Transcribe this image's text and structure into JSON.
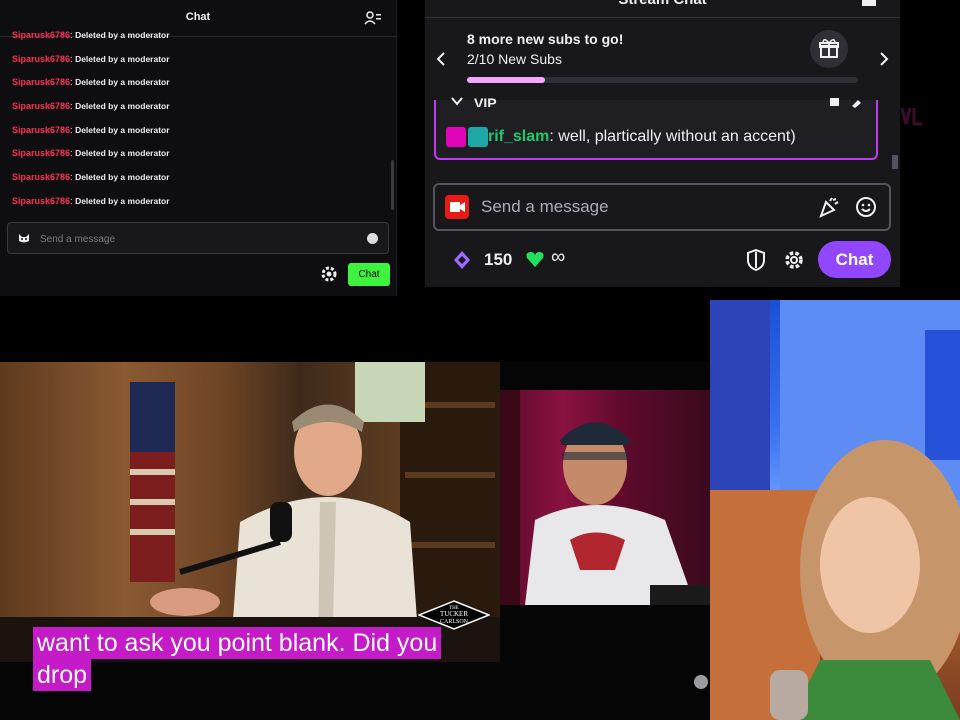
{
  "chatA": {
    "title": "Chat",
    "messages": [
      {
        "user": "Siparusk6786",
        "text": "Deleted by a moderator"
      },
      {
        "user": "Siparusk6786",
        "text": "Deleted by a moderator"
      },
      {
        "user": "Siparusk6786",
        "text": "Deleted by a moderator"
      },
      {
        "user": "Siparusk6786",
        "text": "Deleted by a moderator"
      },
      {
        "user": "Siparusk6786",
        "text": "Deleted by a moderator"
      },
      {
        "user": "Siparusk6786",
        "text": "Deleted by a moderator"
      },
      {
        "user": "Siparusk6786",
        "text": "Deleted by a moderator"
      },
      {
        "user": "Siparusk6786",
        "text": "Deleted by a moderator"
      }
    ],
    "input_placeholder": "Send a message",
    "chat_button": "Chat",
    "accent": "#3df33d"
  },
  "chatB": {
    "title": "Stream Chat",
    "hype": {
      "title": "8 more new subs to go!",
      "subtitle": "2/10 New Subs",
      "progress_fraction": 0.2
    },
    "vip": {
      "label": "VIP",
      "user": "rif_slam",
      "message": ": well, plartically without an accent)"
    },
    "input_placeholder": "Send a message",
    "points": "150",
    "infinity": "∞",
    "chat_button": "Chat",
    "accent": "#9147ff"
  },
  "video": {
    "caption_line1": "want to ask you point blank. Did you",
    "caption_line2": "drop",
    "logo_line1": "THE",
    "logo_line2": "TUCKER",
    "logo_line3": "CARLSON"
  }
}
